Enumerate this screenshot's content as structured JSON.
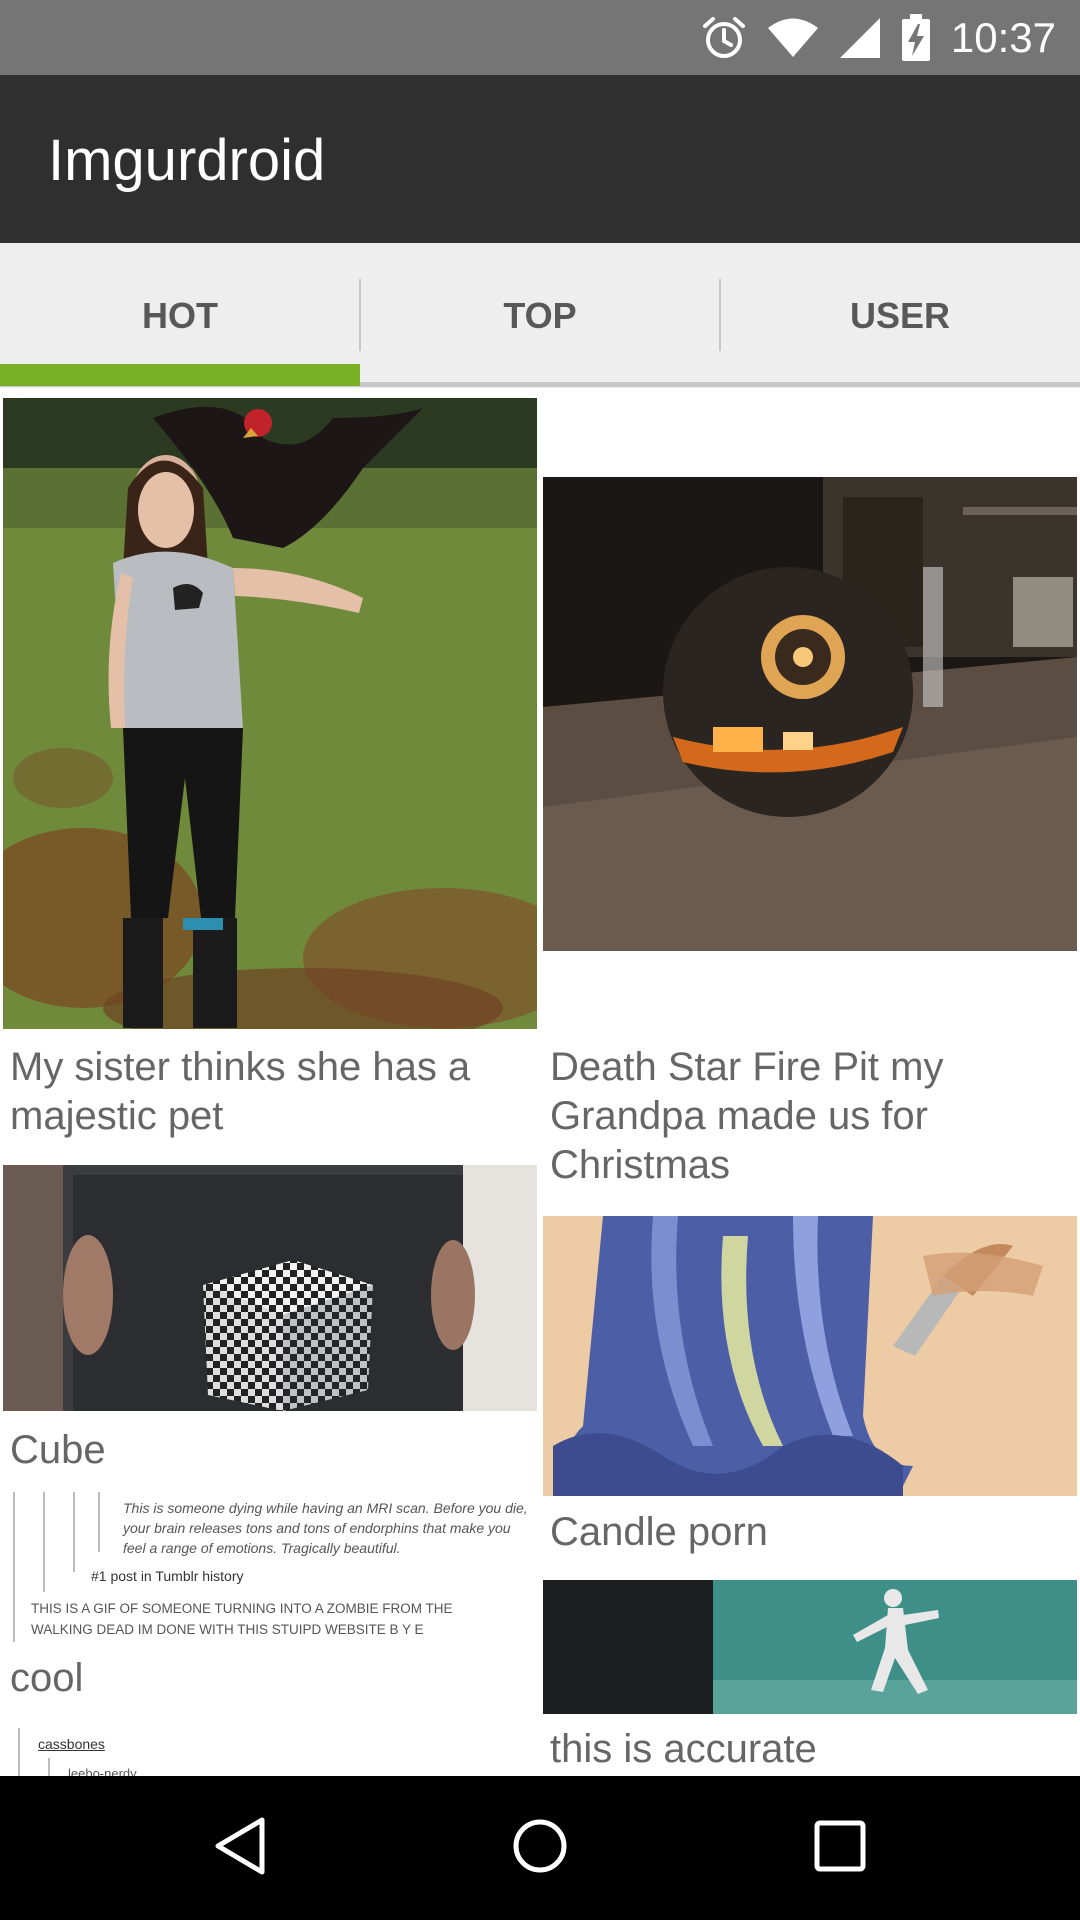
{
  "status_bar": {
    "time": "10:37",
    "icons": [
      "alarm-icon",
      "wifi-icon",
      "cell-signal-icon",
      "battery-charging-icon"
    ]
  },
  "app_bar": {
    "title": "Imgurdroid"
  },
  "tabs": [
    {
      "label": "HOT",
      "selected": true
    },
    {
      "label": "TOP",
      "selected": false
    },
    {
      "label": "USER",
      "selected": false
    }
  ],
  "colors": {
    "accent": "#79b026",
    "app_bar": "#2f2f2f",
    "status_bar": "#757575",
    "tab_bar": "#eeeeee"
  },
  "feed": {
    "left_column": [
      {
        "title": "My sister thinks she has a majestic pet",
        "image": "woman-with-rooster-photo"
      },
      {
        "title": "Cube",
        "image": "checkered-cube-gif"
      },
      {
        "title": "cool",
        "image": "tumblr-screenshot",
        "image_text": {
          "quote": "This is someone dying while having an MRI scan. Before you die, your brain releases tons and tons of endorphins that make you feel a range of emotions. Tragically beautiful.",
          "post_rank": "#1 post in Tumblr history",
          "reply": "THIS IS A GIF OF SOMEONE TURNING INTO A ZOMBIE FROM THE WALKING DEAD IM DONE WITH THIS STUIPD  WEBSITE B Y E"
        }
      },
      {
        "title": "",
        "image": "tumblr-screenshot-2",
        "image_text": {
          "user": "cassbones",
          "user2": "leebo-nerdy"
        }
      }
    ],
    "right_column": [
      {
        "title": "Death Star Fire Pit my Grandpa made us for Christmas",
        "image": "death-star-fire-pit-photo"
      },
      {
        "title": "Candle porn",
        "image": "carved-candle-photo"
      },
      {
        "title": "this is accurate",
        "image": "dancing-figure-gif"
      }
    ]
  },
  "nav_bar": {
    "buttons": [
      "back-icon",
      "home-icon",
      "recents-icon"
    ]
  }
}
